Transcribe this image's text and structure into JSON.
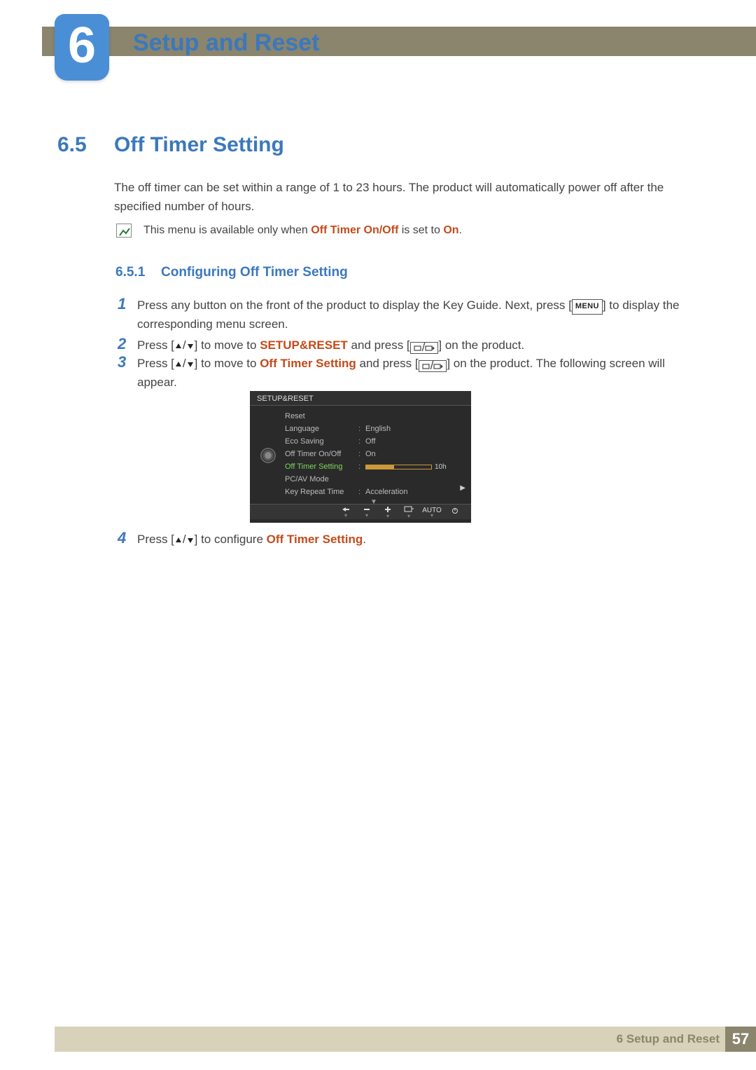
{
  "chapter": {
    "number": "6",
    "title": "Setup and Reset"
  },
  "section": {
    "number": "6.5",
    "title": "Off Timer Setting"
  },
  "intro": "The off timer can be set within a range of 1 to 23 hours. The product will automatically power off after the specified number of hours.",
  "note": {
    "prefix": "This menu is available only when ",
    "bold1": "Off Timer On/Off",
    "mid": " is set to ",
    "bold2": "On",
    "suffix": "."
  },
  "subsection": {
    "number": "6.5.1",
    "title": "Configuring Off Timer Setting"
  },
  "steps": {
    "s1": {
      "num": "1",
      "a": "Press any button on the front of the product to display the Key Guide. Next, press [",
      "menu": "MENU",
      "b": "] to display the corresponding menu screen."
    },
    "s2": {
      "num": "2",
      "a": "Press [",
      "b": "] to move to ",
      "bold": "SETUP&RESET",
      "c": " and press [",
      "d": "] on the product."
    },
    "s3": {
      "num": "3",
      "a": "Press [",
      "b": "] to move to ",
      "bold": "Off Timer Setting",
      "c": " and press [",
      "d": "] on the product. The following screen will appear."
    },
    "s4": {
      "num": "4",
      "a": "Press [",
      "b": "] to configure ",
      "bold": "Off Timer Setting",
      "c": "."
    }
  },
  "osd": {
    "title": "SETUP&RESET",
    "items": [
      {
        "label": "Reset",
        "value": ""
      },
      {
        "label": "Language",
        "value": "English"
      },
      {
        "label": "Eco Saving",
        "value": "Off"
      },
      {
        "label": "Off Timer On/Off",
        "value": "On"
      },
      {
        "label": "Off Timer Setting",
        "value": "10h",
        "selected": true,
        "slider": true
      },
      {
        "label": "PC/AV Mode",
        "value": ""
      },
      {
        "label": "Key Repeat Time",
        "value": "Acceleration"
      }
    ],
    "footer_auto": "AUTO"
  },
  "footer": {
    "chapter": "6 Setup and Reset",
    "page": "57"
  }
}
